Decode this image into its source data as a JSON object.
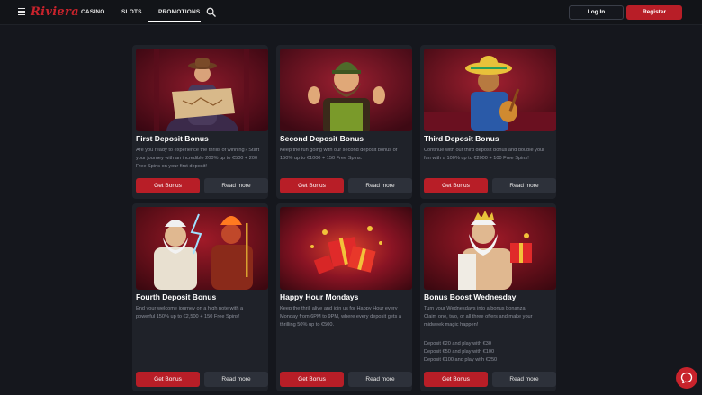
{
  "header": {
    "logo": "Riviera",
    "nav": [
      {
        "label": "CASINO"
      },
      {
        "label": "SLOTS"
      },
      {
        "label": "PROMOTIONS"
      }
    ],
    "login_label": "Log In",
    "register_label": "Register"
  },
  "icons": {
    "menu": "hamburger-icon",
    "search": "search-icon",
    "chat": "chat-icon"
  },
  "colors": {
    "accent": "#b81e27",
    "background": "#15171d",
    "card": "#1f2229"
  },
  "cards": [
    {
      "title": "First Deposit Bonus",
      "desc": [
        "Are you ready to experience the thrills of winning? Start",
        "your journey with an incredible 200% up to €500 + 200",
        "Free Spins on your first deposit!"
      ],
      "extra": [],
      "get_label": "Get Bonus",
      "more_label": "Read more"
    },
    {
      "title": "Second Deposit Bonus",
      "desc": [
        "Keep the fun going with our second deposit bonus of",
        "150% up to €1000 + 150 Free Spins."
      ],
      "extra": [],
      "get_label": "Get Bonus",
      "more_label": "Read more"
    },
    {
      "title": "Third Deposit Bonus",
      "desc": [
        "Continue with our third deposit bonus and double your",
        "fun with a 100% up to €2000 + 100 Free Spins!"
      ],
      "extra": [],
      "get_label": "Get Bonus",
      "more_label": "Read more"
    },
    {
      "title": "Fourth Deposit Bonus",
      "desc": [
        "End your welcome journey on a high note with a",
        "powerful 150% up to €2,500 + 150 Free Spins!"
      ],
      "extra": [],
      "get_label": "Get Bonus",
      "more_label": "Read more"
    },
    {
      "title": "Happy Hour Mondays",
      "desc": [
        "Keep the thrill alive and join us for Happy Hour every",
        "Monday from 6PM to 9PM, where every deposit gets a",
        "thrilling 50% up to €500."
      ],
      "extra": [],
      "get_label": "Get Bonus",
      "more_label": "Read more"
    },
    {
      "title": "Bonus Boost Wednesday",
      "desc": [
        "Turn your Wednesdays into a bonus bonanza!",
        "Claim one, two, or all three offers and make your",
        "midweek magic happen!"
      ],
      "extra": [
        "Deposit €20 and play with €30",
        "Deposit €50 and play with €100",
        "Deposit €100 and play with €250"
      ],
      "get_label": "Get Bonus",
      "more_label": "Read more"
    }
  ]
}
